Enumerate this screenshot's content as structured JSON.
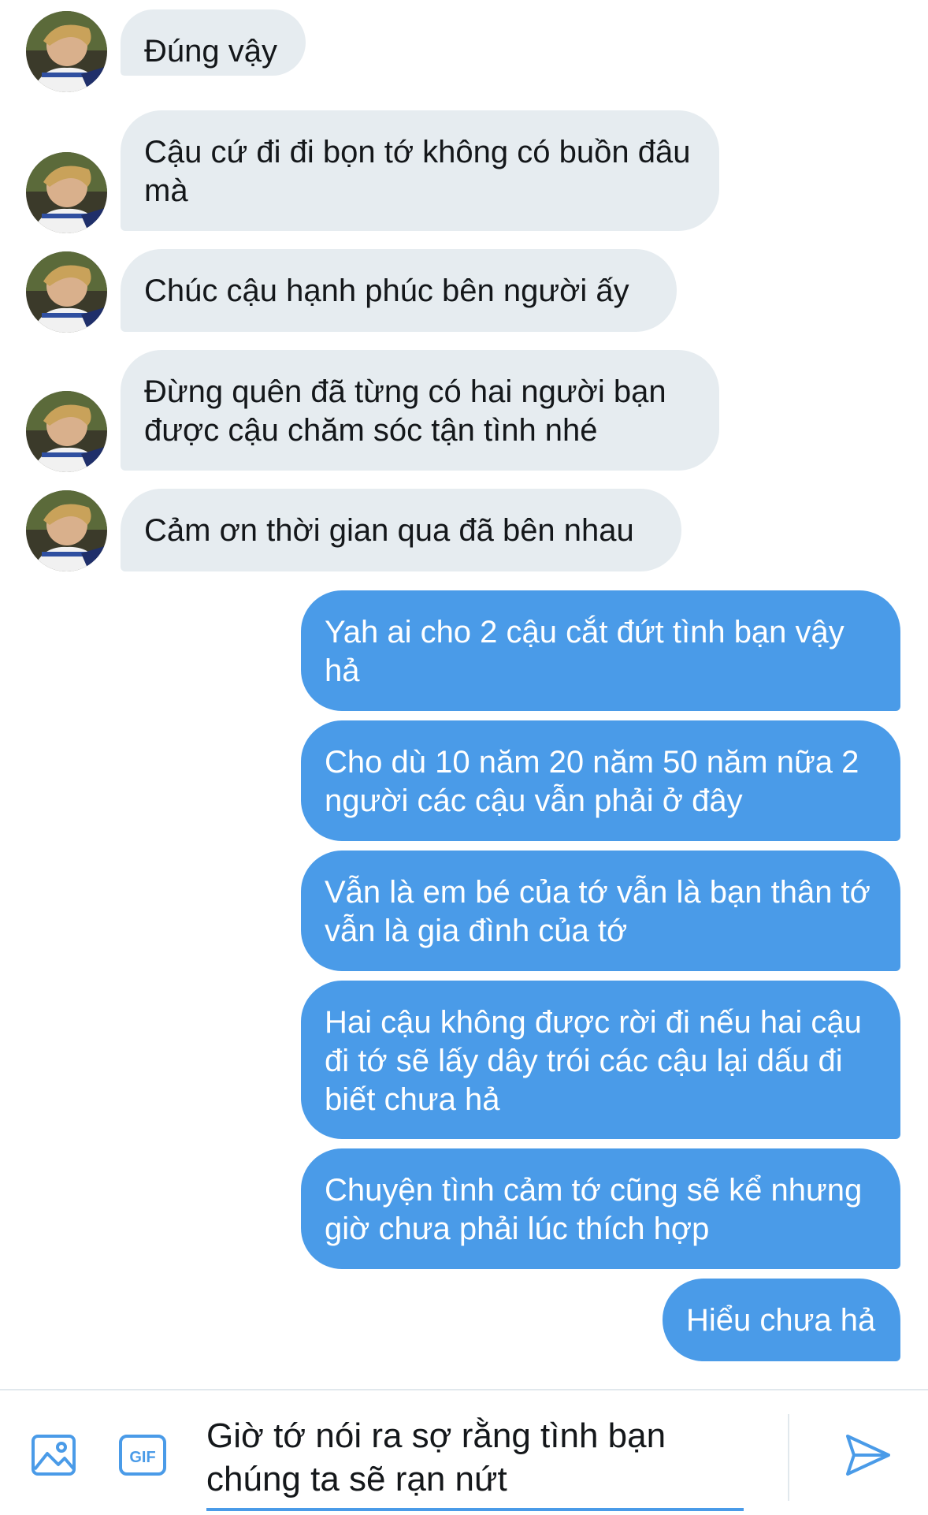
{
  "conversation": {
    "incoming": [
      {
        "text": "Đúng vậy"
      },
      {
        "text": "Cậu cứ đi đi bọn tớ không có buồn đâu mà"
      },
      {
        "text": "Chúc cậu hạnh phúc bên người ấy"
      },
      {
        "text": "Đừng quên đã từng có hai người bạn được cậu chăm sóc tận tình nhé"
      },
      {
        "text": "Cảm ơn thời gian qua đã bên nhau"
      }
    ],
    "outgoing": [
      {
        "text": "Yah ai cho 2 cậu cắt đứt tình bạn vậy hả"
      },
      {
        "text": "Cho dù 10 năm 20 năm 50 năm nữa 2 người các cậu vẫn phải ở đây"
      },
      {
        "text": "Vẫn là em bé của tớ vẫn là bạn thân tớ vẫn là gia đình của tớ"
      },
      {
        "text": "Hai cậu không được rời đi nếu hai cậu đi tớ sẽ lấy dây trói các cậu lại dấu đi biết chưa hả"
      },
      {
        "text": "Chuyện tình cảm tớ cũng sẽ kể nhưng giờ chưa phải lúc thích hợp"
      },
      {
        "text": "Hiểu chưa hả"
      }
    ]
  },
  "composer": {
    "draft_text": "Giờ tớ nói ra sợ rằng tình bạn chúng ta sẽ rạn nứt",
    "gif_label": "GIF",
    "icons": [
      "image-icon",
      "gif-icon",
      "send-icon"
    ]
  },
  "colors": {
    "incoming_bubble": "#e6ecf0",
    "outgoing_bubble": "#4a9be8",
    "accent": "#4a9be8"
  }
}
